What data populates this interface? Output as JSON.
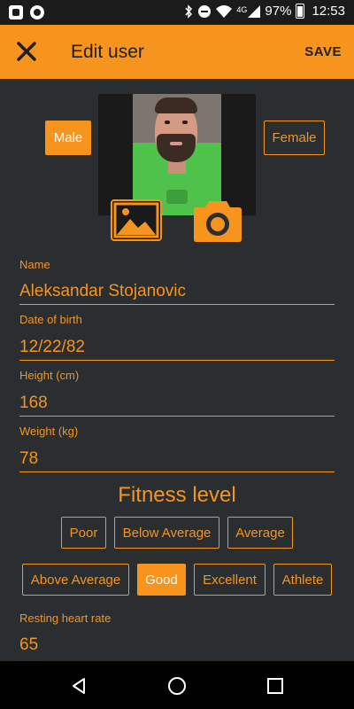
{
  "status_bar": {
    "network_type": "4G",
    "battery": "97%",
    "time": "12:53"
  },
  "app_bar": {
    "title": "Edit user",
    "save_label": "SAVE",
    "close_icon": "close-icon",
    "background": "#f7941d"
  },
  "gender": {
    "male_label": "Male",
    "female_label": "Female",
    "selected": "Male"
  },
  "photo": {
    "gallery_icon": "image-icon",
    "camera_icon": "camera-icon"
  },
  "fields": {
    "name_label": "Name",
    "name_value": "Aleksandar Stojanovic",
    "dob_label": "Date of birth",
    "dob_value": "12/22/82",
    "height_label": "Height (cm)",
    "height_value": "168",
    "weight_label": "Weight (kg)",
    "weight_value": "78",
    "rhr_label": "Resting heart rate",
    "rhr_value": "65"
  },
  "fitness": {
    "title": "Fitness level",
    "options": [
      "Poor",
      "Below Average",
      "Average",
      "Above Average",
      "Good",
      "Excellent",
      "Athlete"
    ],
    "selected": "Good"
  },
  "colors": {
    "accent": "#f7941d",
    "background": "#2b2e31"
  }
}
